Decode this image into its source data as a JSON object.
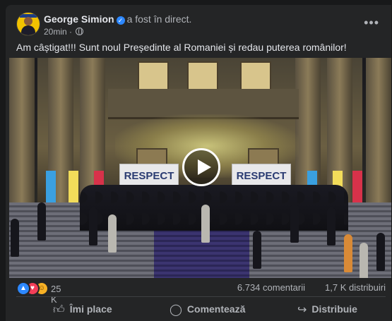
{
  "post": {
    "author": "George Simion",
    "action": "a fost în direct.",
    "time": "20min",
    "separator": "·",
    "text": "Am câștigat!!! Sunt noul Președinte al Romaniei și redau puterea românilor!",
    "banner_left": "RESPECT",
    "banner_right": "RESPECT"
  },
  "icons": {
    "verified": "verified-badge-icon",
    "privacy": "globe-icon",
    "more": "more-options-icon",
    "play": "play-icon"
  },
  "stats": {
    "reaction_count": "25 K",
    "comments": "6.734 comentarii",
    "shares": "1,7 K distribuiri"
  },
  "actions": {
    "like_label": "Îmi place",
    "comment_label": "Comentează",
    "share_label": "Distribuie"
  },
  "colors": {
    "card": "#242526",
    "text": "#e4e6eb",
    "muted": "#b0b3b8",
    "like": "#2d88ff",
    "love": "#f33e58",
    "haha": "#f7b125"
  }
}
